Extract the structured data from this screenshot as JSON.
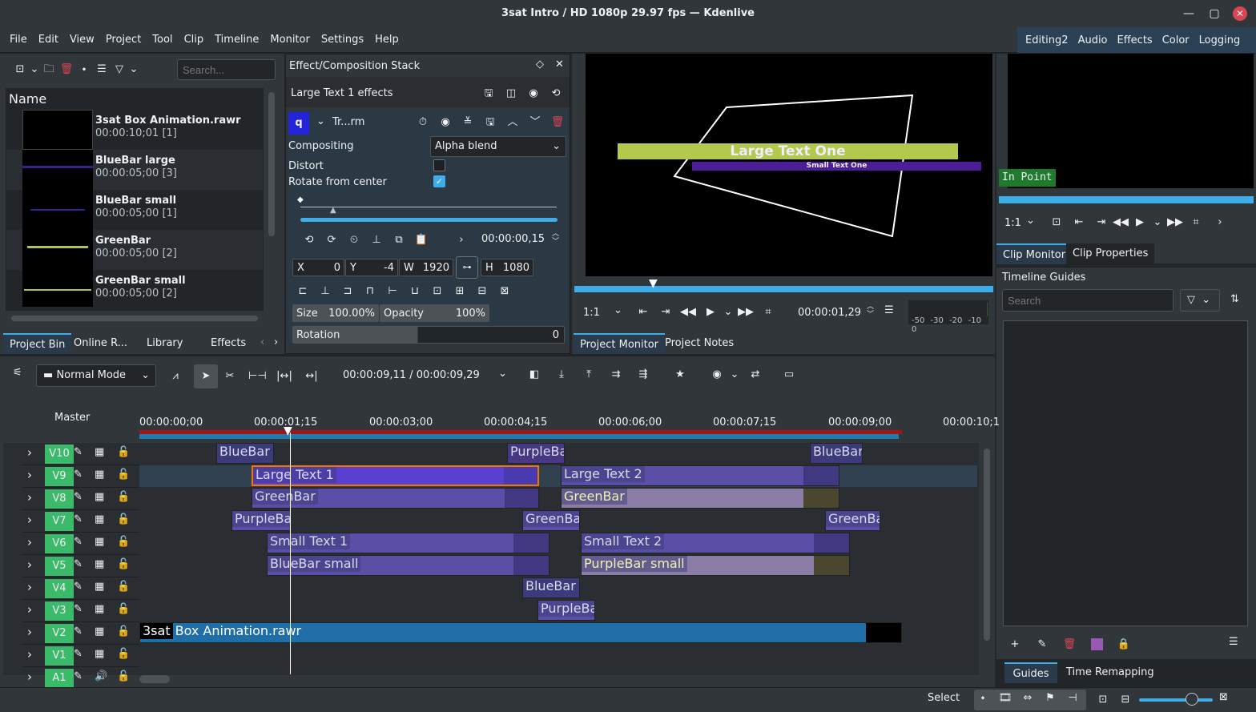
{
  "window": {
    "title": "3sat Intro / HD 1080p 29.97 fps — Kdenlive"
  },
  "menu": [
    "File",
    "Edit",
    "View",
    "Project",
    "Tool",
    "Clip",
    "Timeline",
    "Monitor",
    "Settings",
    "Help"
  ],
  "workspaces": [
    "Editing2",
    "Audio",
    "Effects",
    "Color",
    "Logging"
  ],
  "bin": {
    "search_placeholder": "Search...",
    "header": "Name",
    "items": [
      {
        "name": "3sat Box Animation.rawr",
        "duration": "00:00:10;01 [1]"
      },
      {
        "name": "BlueBar large",
        "duration": "00:00:05;00 [3]",
        "color": "#3c1f8c"
      },
      {
        "name": "BlueBar small",
        "duration": "00:00:05;00 [1]",
        "color": "#3c1f8c"
      },
      {
        "name": "GreenBar",
        "duration": "00:00:05;00 [2]",
        "color": "#b0c44a"
      },
      {
        "name": "GreenBar small",
        "duration": "00:00:05;00 [2]",
        "color": "#b0c44a"
      }
    ],
    "tabs": [
      "Project Bin",
      "Online R...",
      "Library",
      "Effects"
    ]
  },
  "effects": {
    "title": "Effect/Composition Stack",
    "subtitle": "Large Text 1 effects",
    "effect_letter": "q",
    "effect_name": "Tr...rm",
    "compositing_label": "Compositing",
    "compositing_value": "Alpha blend",
    "distort_label": "Distort",
    "rotate_label": "Rotate from center",
    "timecode": "00:00:00,15",
    "x_label": "X",
    "x_value": "0",
    "y_label": "Y",
    "y_value": "-4",
    "w_label": "W",
    "w_value": "1920",
    "h_label": "H",
    "h_value": "1080",
    "size_label": "Size",
    "size_value": "100.00%",
    "opacity_label": "Opacity",
    "opacity_value": "100%",
    "rotation_label": "Rotation",
    "rotation_value": "0"
  },
  "project_monitor": {
    "large_text": "Large Text One",
    "small_text": "Small Text One",
    "zoom": "1:1",
    "timecode": "00:00:01,29",
    "meter": [
      "-50",
      "-30",
      "-20",
      "-10",
      "0"
    ],
    "tabs": [
      "Project Monitor",
      "Project Notes"
    ]
  },
  "clip_monitor": {
    "in_point": "In Point",
    "zoom": "1:1",
    "tabs": [
      "Clip Monitor",
      "Clip Properties"
    ]
  },
  "guides": {
    "title": "Timeline Guides",
    "search_placeholder": "Search",
    "tabs": [
      "Guides",
      "Time Remapping"
    ]
  },
  "timeline": {
    "mode": "Normal Mode",
    "timecode": "00:00:09,11 / 00:00:09,29",
    "master": "Master",
    "ruler": [
      "00:00:00;00",
      "00:00:01;15",
      "00:00:03;00",
      "00:00:04;15",
      "00:00:06;00",
      "00:00:07;15",
      "00:00:09;00",
      "00:00:10;1"
    ],
    "tracks": [
      "V10",
      "V9",
      "V8",
      "V7",
      "V6",
      "V5",
      "V4",
      "V3",
      "V2",
      "V1",
      "A1"
    ],
    "clips": {
      "v10a": "BlueBar",
      "v10b": "PurpleBa",
      "v10c": "BlueBar",
      "v9a": "Large Text 1",
      "v9b": "Large Text 2",
      "v8a": "GreenBar",
      "v8b": "GreenBar",
      "v7a": "PurpleBa",
      "v7b": "GreenBa",
      "v7c": "GreenBa",
      "v6a": "Small Text 1",
      "v6b": "Small Text 2",
      "v5a": "BlueBar small",
      "v5b": "PurpleBar small",
      "v4a": "BlueBar",
      "v3a": "PurpleBa",
      "v2a_prefix": "3sat",
      "v2a": "Box Animation.rawr"
    }
  },
  "status": {
    "mode": "Select"
  }
}
